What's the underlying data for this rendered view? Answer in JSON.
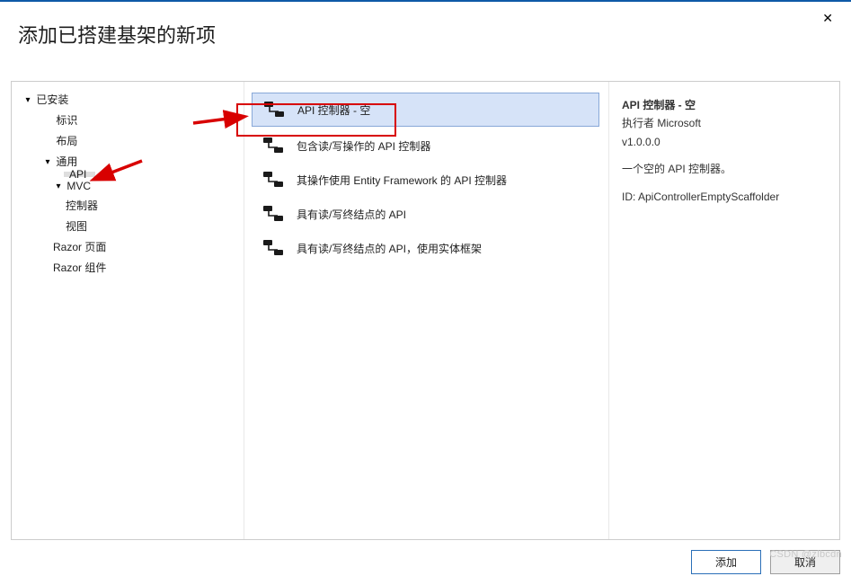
{
  "dialog": {
    "title": "添加已搭建基架的新项",
    "close_label": "✕"
  },
  "sidebar": {
    "root": "已安装",
    "items": [
      {
        "label": "标识",
        "depth": 1,
        "caret": ""
      },
      {
        "label": "布局",
        "depth": 1,
        "caret": ""
      },
      {
        "label": "通用",
        "depth": 1,
        "caret": "▾"
      },
      {
        "label": "API",
        "depth": 2,
        "caret": "",
        "selected": true
      },
      {
        "label": "MVC",
        "depth": 2,
        "caret": "▾"
      },
      {
        "label": "控制器",
        "depth": 3,
        "caret": ""
      },
      {
        "label": "视图",
        "depth": 3,
        "caret": ""
      },
      {
        "label": "Razor 页面",
        "depth": 2,
        "caret": ""
      },
      {
        "label": "Razor 组件",
        "depth": 2,
        "caret": ""
      }
    ]
  },
  "templates": [
    {
      "label": "API 控制器 - 空",
      "selected": true
    },
    {
      "label": "包含读/写操作的 API 控制器"
    },
    {
      "label": "其操作使用 Entity Framework 的 API 控制器"
    },
    {
      "label": "具有读/写终结点的 API"
    },
    {
      "label": "具有读/写终结点的 API，使用实体框架"
    }
  ],
  "details": {
    "title": "API 控制器 - 空",
    "publisher": "执行者 Microsoft",
    "version": "v1.0.0.0",
    "description": "一个空的 API 控制器。",
    "id_line": "ID: ApiControllerEmptyScaffolder"
  },
  "buttons": {
    "add": "添加",
    "cancel": "取消"
  },
  "watermark": "CSDN @zlbcdn"
}
